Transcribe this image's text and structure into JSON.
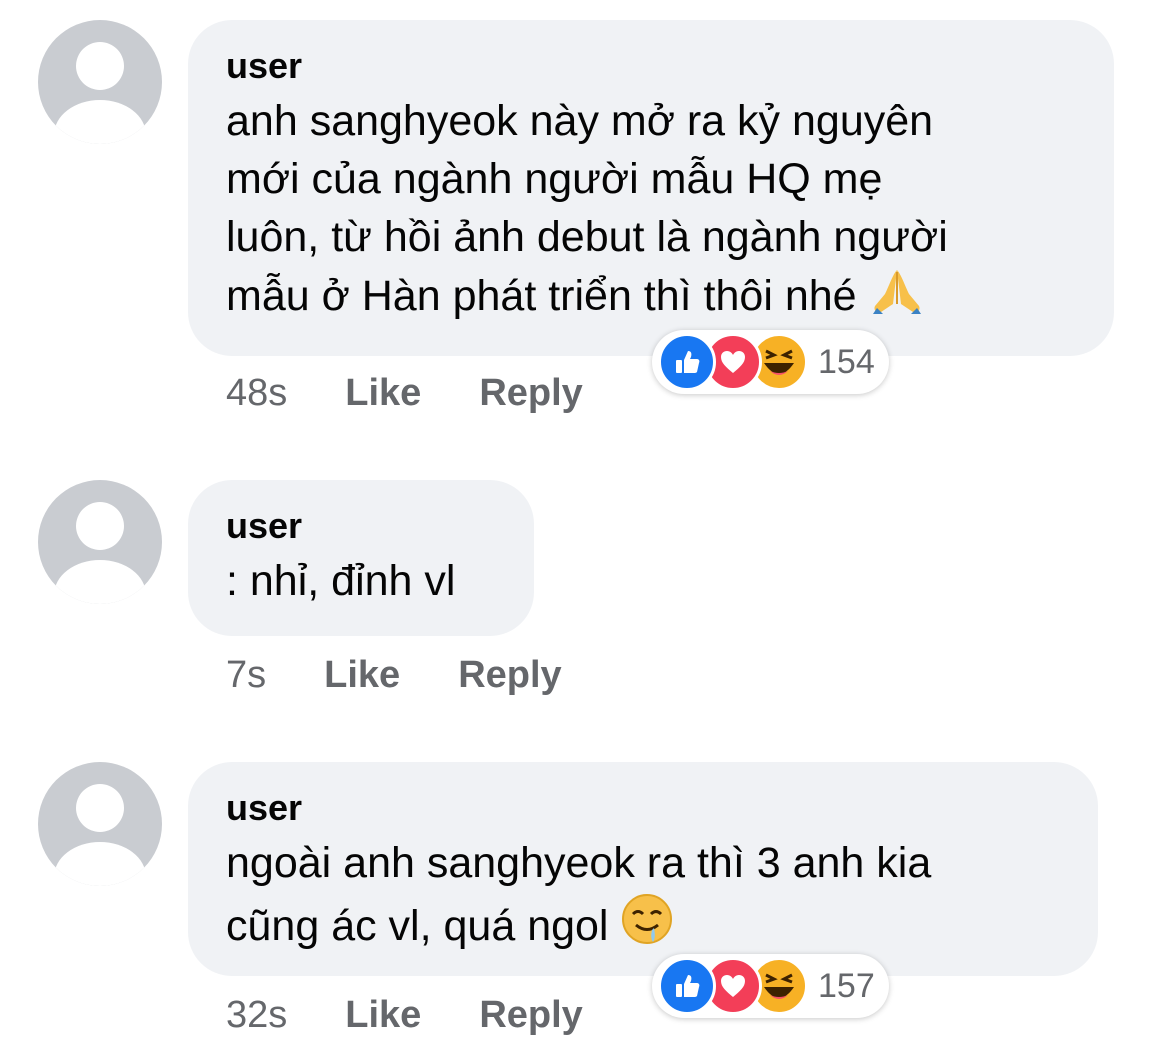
{
  "comments": [
    {
      "author": "user",
      "text": "anh sanghyeok này mở ra kỷ nguyên\nmới của ngành người mẫu HQ mẹ\nluôn, từ hồi ảnh debut là ngành người\nmẫu ở Hàn phát triển thì thôi nhé",
      "trailing_emoji": "folded-hands",
      "time": "48s",
      "like_label": "Like",
      "reply_label": "Reply",
      "reaction_count": "154",
      "reactions": [
        "like",
        "love",
        "haha"
      ]
    },
    {
      "author": "user",
      "text": ": nhỉ, đỉnh vl",
      "time": "7s",
      "like_label": "Like",
      "reply_label": "Reply"
    },
    {
      "author": "user",
      "text": "ngoài anh sanghyeok ra thì 3 anh kia\ncũng ác vl, quá ngol",
      "trailing_emoji": "drooling-face",
      "time": "32s",
      "like_label": "Like",
      "reply_label": "Reply",
      "reaction_count": "157",
      "reactions": [
        "like",
        "love",
        "haha"
      ]
    }
  ],
  "colors": {
    "bubble": "#f0f2f5",
    "meta_text": "#65676b",
    "like_blue": "#1877f2",
    "love_red": "#f33e58",
    "haha_yellow": "#f7b125"
  }
}
